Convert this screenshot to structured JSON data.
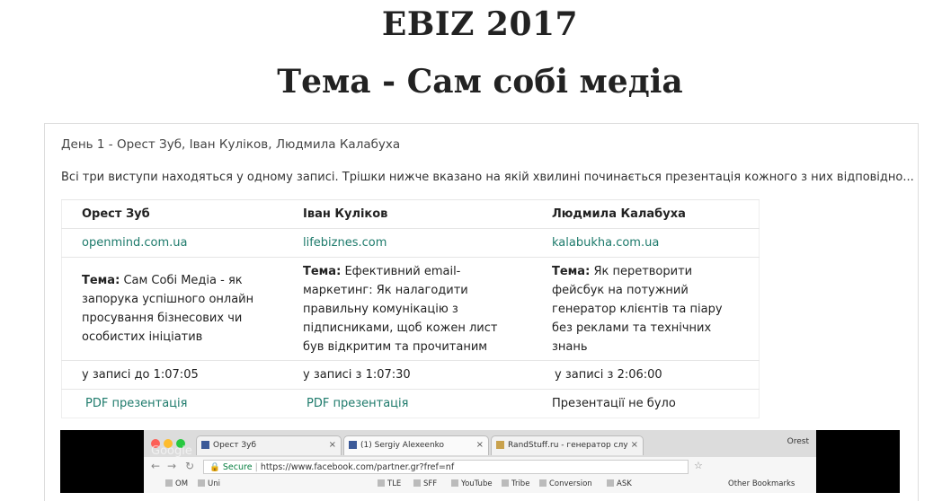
{
  "header": {
    "title": "EBIZ 2017",
    "subtitle": "Тема - Сам собі медіа"
  },
  "card": {
    "day": "День 1 - Орест Зуб, Іван Куліков, Людмила Калабуха",
    "intro": "Всі три виступи находяться у одному записі. Трішки нижче вказано на якій хвилині починається презентація кожного з них відповідно...",
    "topic_label": "Тема:",
    "speakers": [
      {
        "name": "Орест Зуб",
        "site": "openmind.com.ua",
        "topic": "Сам Собі Медіа - як запорука успішного онлайн просування бізнесових чи особистих ініціатив",
        "time": "у записі до 1:07:05",
        "presentation": "PDF презентація"
      },
      {
        "name": "Іван Куліков",
        "site": "lifebiznes.com",
        "topic": "Ефективний email-маркетинг: Як налагодити правильну комунікацію з підписниками, щоб кожен лист був відкритим та прочитаним",
        "time": "у записі з 1:07:30",
        "presentation": "PDF презентація"
      },
      {
        "name": "Людмила Калабуха",
        "site": "kalabukha.com.ua",
        "topic": "Як перетворити фейсбук на потужний генератор клієнтів та піару без реклами та технічних знань",
        "time": "у записі з 2:06:00",
        "presentation": "Презентації не було"
      }
    ]
  },
  "video": {
    "watermark": "Google",
    "browser": {
      "tabs": [
        {
          "label": "Орест Зуб"
        },
        {
          "label": "(1) Sergiy Alexeenko"
        },
        {
          "label": "RandStuff.ru - генератор слу"
        }
      ],
      "profile": "Orest",
      "secure_label": "Secure",
      "url": "https://www.facebook.com/partner.gr?fref=nf",
      "bookmarks": [
        "OM",
        "Uni",
        "TLE",
        "SFF",
        "YouTube",
        "Tribe",
        "Conversion",
        "ASK",
        "Other Bookmarks"
      ]
    }
  },
  "colors": {
    "link": "#1d7a6b",
    "title": "#222222",
    "facebook": "#3b5998"
  }
}
